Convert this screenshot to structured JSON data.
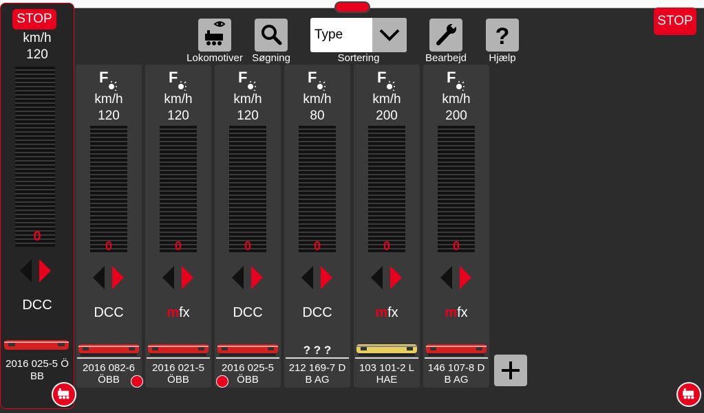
{
  "header": {
    "stop_label": "STOP",
    "tools": [
      {
        "label": "Lokomotiver",
        "icon": "locomotive-eye-icon"
      },
      {
        "label": "Søgning",
        "icon": "search-icon"
      },
      {
        "label": "Bearbejd",
        "icon": "wrench-icon"
      },
      {
        "label": "Hjælp",
        "icon": "help-icon"
      }
    ],
    "sort": {
      "value": "Type",
      "label": "Sortering"
    }
  },
  "active_loco": {
    "stop_label": "STOP",
    "unit": "km/h",
    "max_speed": "120",
    "speed": "0",
    "protocol": "DCC",
    "name": "2016 025-5 Ö BB"
  },
  "locos": [
    {
      "unit": "km/h",
      "max_speed": "120",
      "speed": "0",
      "protocol": "DCC",
      "name_line1": "2016 082-6",
      "name_line2": "ÖBB",
      "image": "obb-red-diesel"
    },
    {
      "unit": "km/h",
      "max_speed": "120",
      "speed": "0",
      "protocol": "mfx",
      "name_line1": "2016 021-5",
      "name_line2": "ÖBB",
      "image": "obb-red-diesel"
    },
    {
      "unit": "km/h",
      "max_speed": "120",
      "speed": "0",
      "protocol": "DCC",
      "name_line1": "2016 025-5",
      "name_line2": "ÖBB",
      "image": "obb-red-diesel"
    },
    {
      "unit": "km/h",
      "max_speed": "80",
      "speed": "0",
      "protocol": "DCC",
      "name_line1": "212 169-7 D",
      "name_line2": "B AG",
      "image": "unknown",
      "image_text": "? ? ?"
    },
    {
      "unit": "km/h",
      "max_speed": "200",
      "speed": "0",
      "protocol": "mfx",
      "name_line1": "103 101-2 L",
      "name_line2": "HAE",
      "image": "yellow-electric"
    },
    {
      "unit": "km/h",
      "max_speed": "200",
      "speed": "0",
      "protocol": "mfx",
      "name_line1": "146 107-8 D",
      "name_line2": "B AG",
      "image": "red-electric"
    }
  ],
  "colors": {
    "accent": "#e8001c",
    "background": "#2c2c2c",
    "column": "#3a3a3a",
    "button": "#b3b3b3"
  }
}
